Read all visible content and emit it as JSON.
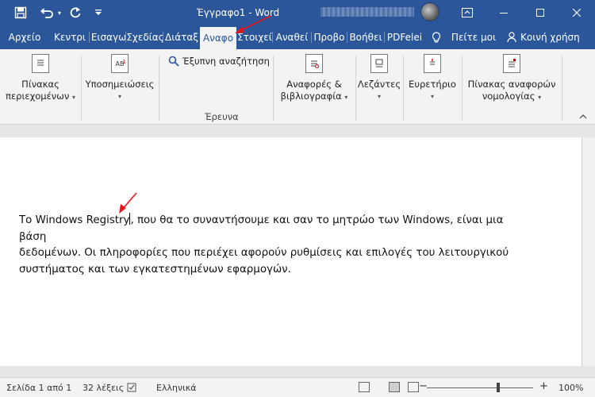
{
  "titlebar": {
    "doc_title": "Έγγραφο1 - Word",
    "save_icon": "save-icon",
    "undo_icon": "undo-icon",
    "redo_icon": "redo-icon",
    "customize_icon": "customize-quick-access-icon",
    "bg_color": "#2b579a"
  },
  "tabs": [
    {
      "label": "Αρχείο",
      "active": false
    },
    {
      "label": "Κεντρι",
      "active": false
    },
    {
      "label": "Εισαγω",
      "active": false
    },
    {
      "label": "Σχεδίας",
      "active": false
    },
    {
      "label": "Διάταξ",
      "active": false
    },
    {
      "label": "Αναφο",
      "active": true
    },
    {
      "label": "Στοιχεί",
      "active": false
    },
    {
      "label": "Αναθεί",
      "active": false
    },
    {
      "label": "Προβο",
      "active": false
    },
    {
      "label": "Βοήθει",
      "active": false
    },
    {
      "label": "PDFelei",
      "active": false
    },
    {
      "label": "Πείτε μοι",
      "active": false
    },
    {
      "label": "Κοινή χρήση",
      "active": false
    }
  ],
  "ribbon": {
    "toc": {
      "line1": "Πίνακας",
      "line2": "περιεχομένων"
    },
    "footnotes": {
      "label": "Υποσημειώσεις",
      "icon_text": "AB"
    },
    "smart_lookup": "Έξυπνη αναζήτηση",
    "research_group": "Έρευνα",
    "citations": {
      "line1": "Αναφορές &",
      "line2": "βιβλιογραφία"
    },
    "captions": "Λεζάντες",
    "index": "Ευρετήριο",
    "toa": {
      "line1": "Πίνακας αναφορών",
      "line2": "νομολογίας"
    }
  },
  "document": {
    "line1_before_caret": "Το Windows Registry",
    "line1_after_caret": ", που θα το συναντήσουμε και σαν το μητρώο των Windows, είναι μια βάση",
    "line2": "δεδομένων. Οι πληροφορίες που περιέχει αφορούν ρυθμίσεις και επιλογές του λειτουργικού",
    "line3": "συστήματος και των εγκατεστημένων εφαρμογών."
  },
  "status": {
    "page": "Σελίδα 1 από 1",
    "words": "32 λέξεις",
    "language": "Ελληνικά",
    "zoom_minus": "−",
    "zoom_plus": "+",
    "zoom": "100%",
    "zoom_fraction": 0.67
  },
  "annotation_color": "#e8161b"
}
